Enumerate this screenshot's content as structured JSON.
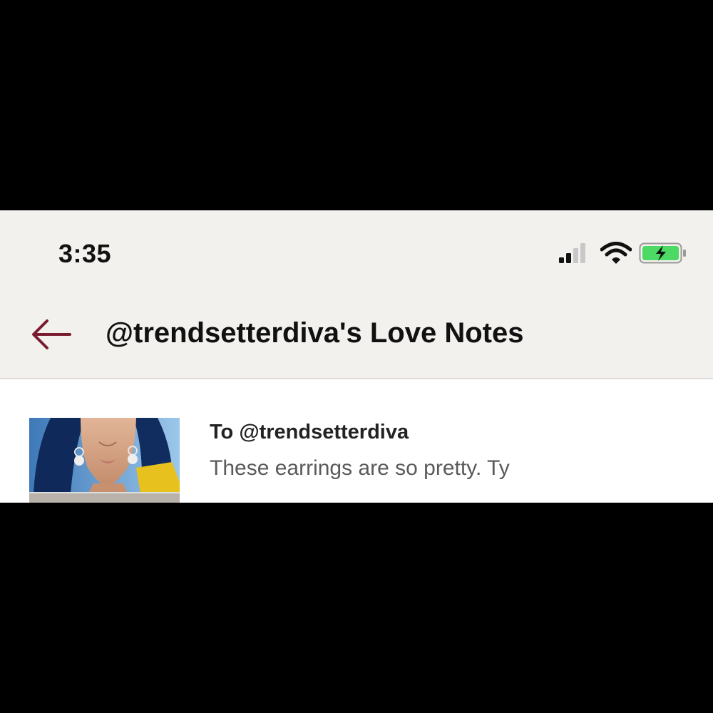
{
  "status_bar": {
    "time": "3:35",
    "signal_icon": "cellular-signal-icon",
    "wifi_icon": "wifi-icon",
    "battery_icon": "battery-charging-icon",
    "battery_color": "#4cd964"
  },
  "header": {
    "back_icon": "arrow-left-icon",
    "back_color": "#7a1c2f",
    "title": "@trendsetterdiva's Love Notes"
  },
  "notes": [
    {
      "recipient": "To @trendsetterdiva",
      "message": "These earrings are so pretty. Ty",
      "thumbnail": "product-photo-earrings"
    }
  ]
}
